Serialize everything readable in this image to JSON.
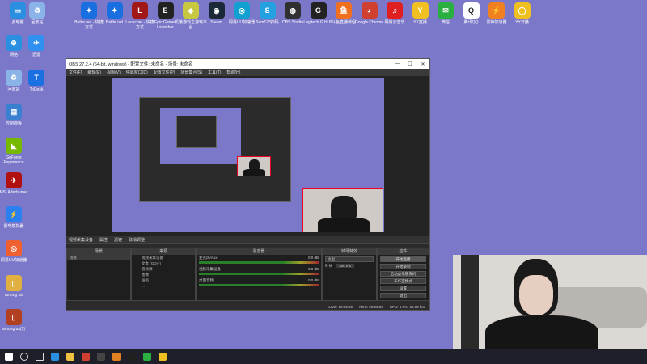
{
  "desktop": {
    "top_icons": [
      {
        "label": "此电脑",
        "color": "#2a8fe0",
        "glyph": "▭"
      },
      {
        "label": "回收站",
        "color": "#8ab4e8",
        "glyph": "♻"
      },
      {
        "label": "Battle.net - 快捷方式",
        "color": "#1a6fe0",
        "glyph": "✦"
      },
      {
        "label": "Battle.net",
        "color": "#1a6fe0",
        "glyph": "✦"
      },
      {
        "label": "Launcher - 快捷方式",
        "color": "#a01818",
        "glyph": "L"
      },
      {
        "label": "Epic Games Launcher",
        "color": "#222222",
        "glyph": "E"
      },
      {
        "label": "饥饿游戏之游戏平台",
        "color": "#c8c840",
        "glyph": "◆"
      },
      {
        "label": "Steam",
        "color": "#1b2838",
        "glyph": "◉"
      },
      {
        "label": "网易UU加速器",
        "color": "#12a0d0",
        "glyph": "◎"
      },
      {
        "label": "Sam123扫码",
        "color": "#23a0e0",
        "glyph": "S"
      },
      {
        "label": "OBS Studio",
        "color": "#303030",
        "glyph": "◍"
      },
      {
        "label": "Logitech G HUB",
        "color": "#222222",
        "glyph": "G"
      },
      {
        "label": "斗鱼直播伴侣",
        "color": "#f07020",
        "glyph": "鱼"
      },
      {
        "label": "Google Chrome",
        "color": "#d04030",
        "glyph": "◕"
      },
      {
        "label": "网易云音乐",
        "color": "#e02020",
        "glyph": "♫"
      },
      {
        "label": "YY直播",
        "color": "#f0c020",
        "glyph": "Y"
      },
      {
        "label": "微信",
        "color": "#2ab040",
        "glyph": "✉"
      },
      {
        "label": "腾讯QQ",
        "color": "#ffffff",
        "glyph": "Q"
      },
      {
        "label": "雷神加速器",
        "color": "#f08020",
        "glyph": "⚡"
      },
      {
        "label": "YY开播",
        "color": "#f0c020",
        "glyph": "◯"
      }
    ],
    "left_icons": [
      {
        "label": "网络",
        "color": "#2a8fe0",
        "glyph": "⊕"
      },
      {
        "label": "迅雷",
        "color": "#3090f0",
        "glyph": "✈"
      },
      {
        "label": "回收站",
        "color": "#8ab4e8",
        "glyph": "♻"
      },
      {
        "label": "ToDesk",
        "color": "#1a70e0",
        "glyph": "T"
      },
      {
        "label": "控制面板",
        "color": "#3a80d0",
        "glyph": "▤"
      },
      {
        "label": "GeForce Experience",
        "color": "#76b900",
        "glyph": "◣"
      },
      {
        "label": "MSI Afterburner",
        "color": "#b01010",
        "glyph": "✈"
      },
      {
        "label": "雷电模拟器",
        "color": "#2a80f0",
        "glyph": "⚡"
      },
      {
        "label": "网易UU加速器",
        "color": "#f06030",
        "glyph": "◎"
      },
      {
        "label": "among us",
        "color": "#e0b040",
        "glyph": "▯"
      },
      {
        "label": "among us(1)",
        "color": "#b04020",
        "glyph": "▯"
      }
    ]
  },
  "obs": {
    "title": "OBS 27.2.4 (64-bit, windows) - 配置文件: 未命名 - 场景: 未命名",
    "window_buttons": [
      "—",
      "☐",
      "✕"
    ],
    "menu": [
      "文件(F)",
      "编辑(E)",
      "视图(V)",
      "停靠窗口(D)",
      "配置文件(P)",
      "场景集合(S)",
      "工具(T)",
      "帮助(H)"
    ],
    "source_tab": "视频采集设备",
    "source_toolbar": [
      "属性",
      "滤镜",
      "取消调整"
    ],
    "docks": {
      "scenes": {
        "title": "场景",
        "items": [
          "场景"
        ]
      },
      "sources": {
        "title": "来源",
        "items": [
          "视频采集设备",
          "文本 (GDI+)",
          "音频源",
          "图像",
          "画板",
          "..."
        ]
      },
      "mixer": {
        "title": "混音器",
        "channels": [
          {
            "name": "麦克风/Aux",
            "db": "0.0 dB"
          },
          {
            "name": "视频采集设备",
            "db": "0.0 dB"
          },
          {
            "name": "桌面音频",
            "db": "0.0 dB"
          }
        ]
      },
      "transitions": {
        "title": "转场特效",
        "mode": "淡出",
        "duration_label": "时长",
        "duration": "300 ms"
      },
      "controls": {
        "title": "控件",
        "buttons": [
          "开始直播",
          "开始录制",
          "启动虚拟摄像机",
          "工作室模式",
          "设置",
          "退出"
        ]
      }
    },
    "status": {
      "live": "LIVE: 00:00:00",
      "rec": "REC: 00:00:00",
      "cpu": "CPU: 0.0%, 60.00 fps"
    }
  },
  "taskbar": {
    "items": [
      {
        "name": "windows-start-icon",
        "color": "#ffffff"
      },
      {
        "name": "search-icon",
        "color": "#dddddd"
      },
      {
        "name": "task-view-icon",
        "color": "#dddddd"
      },
      {
        "name": "edge-icon",
        "color": "#2a8fe0"
      },
      {
        "name": "explorer-icon",
        "color": "#f0c040"
      },
      {
        "name": "chrome-icon",
        "color": "#d04030"
      },
      {
        "name": "obs-icon",
        "color": "#444444"
      },
      {
        "name": "launcher-icon",
        "color": "#e08020"
      },
      {
        "name": "app-icon",
        "color": "#202020"
      },
      {
        "name": "wechat-icon",
        "color": "#2ab040"
      },
      {
        "name": "yy-icon",
        "color": "#f0c020"
      }
    ]
  }
}
